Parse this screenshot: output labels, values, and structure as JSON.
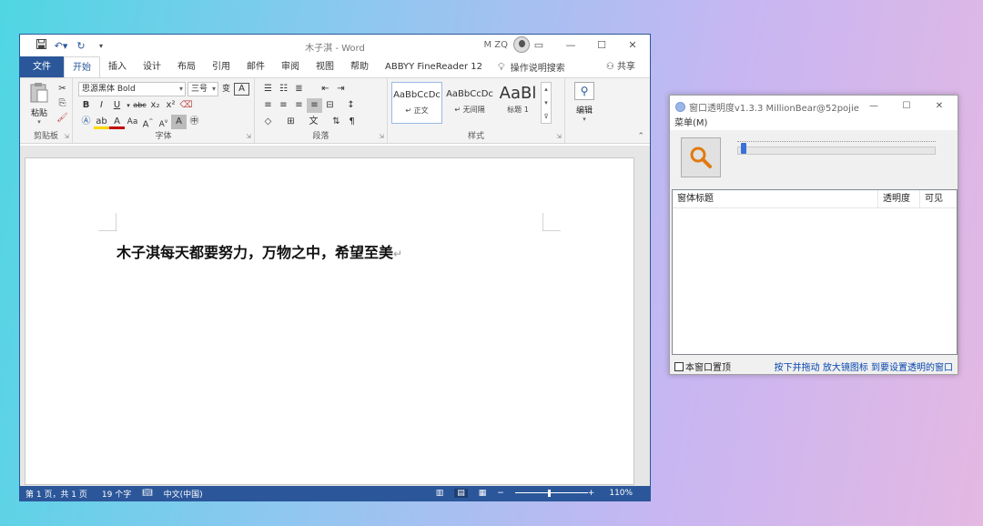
{
  "word": {
    "title": "木子淇 - Word",
    "user": "M ZQ",
    "tabs": [
      "文件",
      "开始",
      "插入",
      "设计",
      "布局",
      "引用",
      "邮件",
      "审阅",
      "视图",
      "帮助",
      "ABBYY FineReader 12"
    ],
    "active_tab": "开始",
    "tell_me": "操作说明搜索",
    "share": "共享",
    "ribbon": {
      "clipboard": {
        "label": "剪贴板",
        "paste": "粘贴"
      },
      "font": {
        "label": "字体",
        "name": "思源黑体 Bold",
        "size": "三号",
        "wen": "变",
        "a_box": "A"
      },
      "paragraph": {
        "label": "段落"
      },
      "styles": {
        "label": "样式",
        "items": [
          {
            "preview": "AaBbCcDc",
            "name": "↵ 正文"
          },
          {
            "preview": "AaBbCcDc",
            "name": "↵ 无间隔"
          },
          {
            "preview": "AaBl",
            "name": "标题 1"
          }
        ]
      },
      "editing": {
        "label": "编辑"
      }
    },
    "document_text": "木子淇每天都要努力，万物之中，希望至美",
    "para_mark": "↵",
    "status": {
      "page": "第 1 页，共 1 页",
      "words": "19 个字",
      "lang": "中文(中国)",
      "zoom": "110%",
      "zoom_level": 0.55
    }
  },
  "tool": {
    "title": "窗口透明度v1.3.3   MillionBear@52pojie",
    "menu": "菜单(M)",
    "slider_value": 0.02,
    "columns": [
      "窗体标题",
      "透明度",
      "可见"
    ],
    "topmost_label": "本窗口置顶",
    "hint": "按下并拖动 放大镜图标 到要设置透明的窗口"
  },
  "colors": {
    "word_blue": "#2b579a",
    "accent": "#3a6fd8",
    "magnifier": "#e07a10"
  }
}
